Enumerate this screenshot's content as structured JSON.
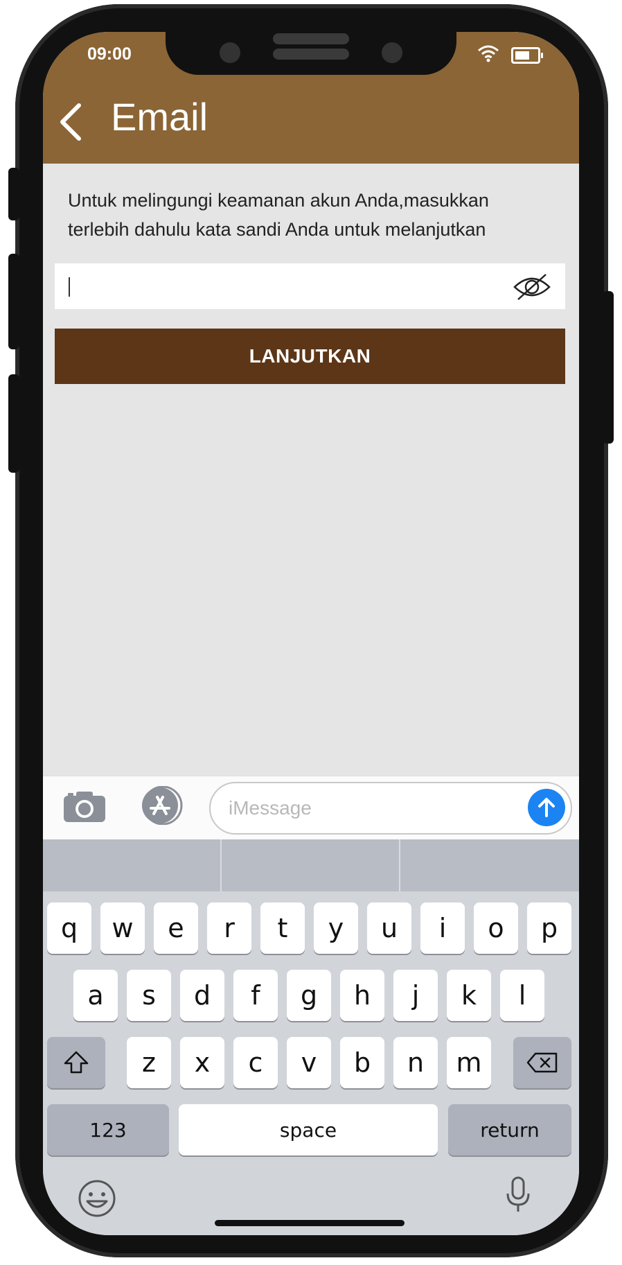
{
  "status": {
    "time": "09:00"
  },
  "header": {
    "title": "Email"
  },
  "prompt": {
    "text": "Untuk melingungi keamanan akun Anda,masukkan terlebih dahulu kata sandi Anda untuk melanjutkan"
  },
  "password_field": {
    "value": "",
    "placeholder": ""
  },
  "continue_button": {
    "label": "LANJUTKAN"
  },
  "imessage": {
    "placeholder": "iMessage"
  },
  "keyboard": {
    "row1": [
      "q",
      "w",
      "e",
      "r",
      "t",
      "y",
      "u",
      "i",
      "o",
      "p"
    ],
    "row2": [
      "a",
      "s",
      "d",
      "f",
      "g",
      "h",
      "j",
      "k",
      "l"
    ],
    "row3": [
      "z",
      "x",
      "c",
      "v",
      "b",
      "n",
      "m"
    ],
    "numbers_key": "123",
    "space_key": "space",
    "return_key": "return"
  },
  "colors": {
    "header": "#8b6536",
    "button": "#5c3617",
    "background": "#e5e5e5",
    "send": "#1b84f2"
  }
}
